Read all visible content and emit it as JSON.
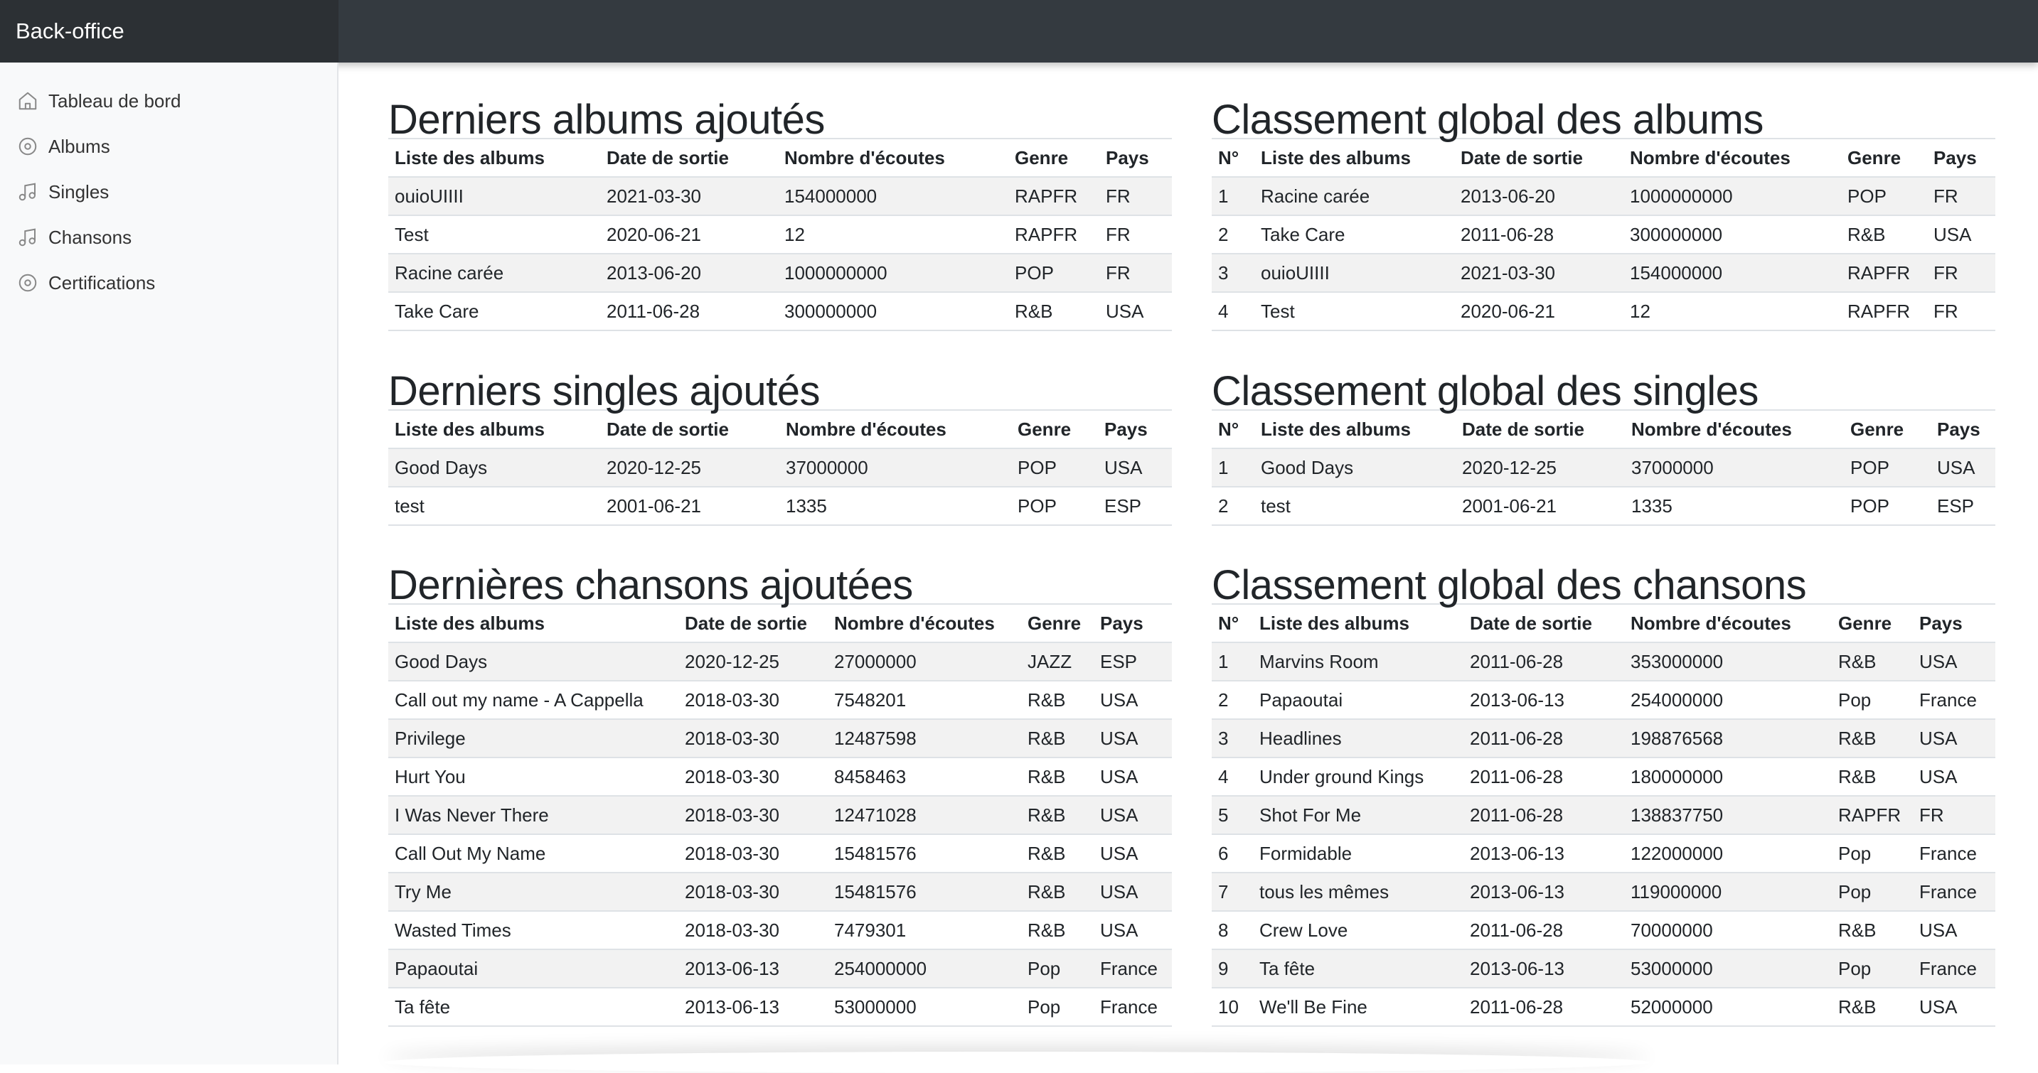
{
  "app": {
    "brand": "Back-office"
  },
  "sidebar": {
    "items": [
      {
        "label": "Tableau de bord",
        "icon": "home-icon"
      },
      {
        "label": "Albums",
        "icon": "disc-icon"
      },
      {
        "label": "Singles",
        "icon": "music-note-icon"
      },
      {
        "label": "Chansons",
        "icon": "music-note-icon"
      },
      {
        "label": "Certifications",
        "icon": "disc-icon"
      }
    ]
  },
  "latest_albums": {
    "title": "Derniers albums ajoutés",
    "headers": [
      "Liste des albums",
      "Date de sortie",
      "Nombre d'écoutes",
      "Genre",
      "Pays"
    ],
    "rows": [
      [
        "ouioUIIII",
        "2021-03-30",
        "154000000",
        "RAPFR",
        "FR"
      ],
      [
        "Test",
        "2020-06-21",
        "12",
        "RAPFR",
        "FR"
      ],
      [
        "Racine carée",
        "2013-06-20",
        "1000000000",
        "POP",
        "FR"
      ],
      [
        "Take Care",
        "2011-06-28",
        "300000000",
        "R&B",
        "USA"
      ]
    ]
  },
  "album_ranking": {
    "title": "Classement global des albums",
    "headers": [
      "N°",
      "Liste des albums",
      "Date de sortie",
      "Nombre d'écoutes",
      "Genre",
      "Pays"
    ],
    "rows": [
      [
        "1",
        "Racine carée",
        "2013-06-20",
        "1000000000",
        "POP",
        "FR"
      ],
      [
        "2",
        "Take Care",
        "2011-06-28",
        "300000000",
        "R&B",
        "USA"
      ],
      [
        "3",
        "ouioUIIII",
        "2021-03-30",
        "154000000",
        "RAPFR",
        "FR"
      ],
      [
        "4",
        "Test",
        "2020-06-21",
        "12",
        "RAPFR",
        "FR"
      ]
    ]
  },
  "latest_singles": {
    "title": "Derniers singles ajoutés",
    "headers": [
      "Liste des albums",
      "Date de sortie",
      "Nombre d'écoutes",
      "Genre",
      "Pays"
    ],
    "rows": [
      [
        "Good Days",
        "2020-12-25",
        "37000000",
        "POP",
        "USA"
      ],
      [
        "test",
        "2001-06-21",
        "1335",
        "POP",
        "ESP"
      ]
    ]
  },
  "single_ranking": {
    "title": "Classement global des singles",
    "headers": [
      "N°",
      "Liste des albums",
      "Date de sortie",
      "Nombre d'écoutes",
      "Genre",
      "Pays"
    ],
    "rows": [
      [
        "1",
        "Good Days",
        "2020-12-25",
        "37000000",
        "POP",
        "USA"
      ],
      [
        "2",
        "test",
        "2001-06-21",
        "1335",
        "POP",
        "ESP"
      ]
    ]
  },
  "latest_songs": {
    "title": "Dernières chansons ajoutées",
    "headers": [
      "Liste des albums",
      "Date de sortie",
      "Nombre d'écoutes",
      "Genre",
      "Pays"
    ],
    "rows": [
      [
        "Good Days",
        "2020-12-25",
        "27000000",
        "JAZZ",
        "ESP"
      ],
      [
        "Call out my name - A Cappella",
        "2018-03-30",
        "7548201",
        "R&B",
        "USA"
      ],
      [
        "Privilege",
        "2018-03-30",
        "12487598",
        "R&B",
        "USA"
      ],
      [
        "Hurt You",
        "2018-03-30",
        "8458463",
        "R&B",
        "USA"
      ],
      [
        "I Was Never There",
        "2018-03-30",
        "12471028",
        "R&B",
        "USA"
      ],
      [
        "Call Out My Name",
        "2018-03-30",
        "15481576",
        "R&B",
        "USA"
      ],
      [
        "Try Me",
        "2018-03-30",
        "15481576",
        "R&B",
        "USA"
      ],
      [
        "Wasted Times",
        "2018-03-30",
        "7479301",
        "R&B",
        "USA"
      ],
      [
        "Papaoutai",
        "2013-06-13",
        "254000000",
        "Pop",
        "France"
      ],
      [
        "Ta fête",
        "2013-06-13",
        "53000000",
        "Pop",
        "France"
      ]
    ]
  },
  "song_ranking": {
    "title": "Classement global des chansons",
    "headers": [
      "N°",
      "Liste des albums",
      "Date de sortie",
      "Nombre d'écoutes",
      "Genre",
      "Pays"
    ],
    "rows": [
      [
        "1",
        "Marvins Room",
        "2011-06-28",
        "353000000",
        "R&B",
        "USA"
      ],
      [
        "2",
        "Papaoutai",
        "2013-06-13",
        "254000000",
        "Pop",
        "France"
      ],
      [
        "3",
        "Headlines",
        "2011-06-28",
        "198876568",
        "R&B",
        "USA"
      ],
      [
        "4",
        "Under ground Kings",
        "2011-06-28",
        "180000000",
        "R&B",
        "USA"
      ],
      [
        "5",
        "Shot For Me",
        "2011-06-28",
        "138837750",
        "RAPFR",
        "FR"
      ],
      [
        "6",
        "Formidable",
        "2013-06-13",
        "122000000",
        "Pop",
        "France"
      ],
      [
        "7",
        "tous les mêmes",
        "2013-06-13",
        "119000000",
        "Pop",
        "France"
      ],
      [
        "8",
        "Crew Love",
        "2011-06-28",
        "70000000",
        "R&B",
        "USA"
      ],
      [
        "9",
        "Ta fête",
        "2013-06-13",
        "53000000",
        "Pop",
        "France"
      ],
      [
        "10",
        "We'll Be Fine",
        "2011-06-28",
        "52000000",
        "R&B",
        "USA"
      ]
    ]
  }
}
